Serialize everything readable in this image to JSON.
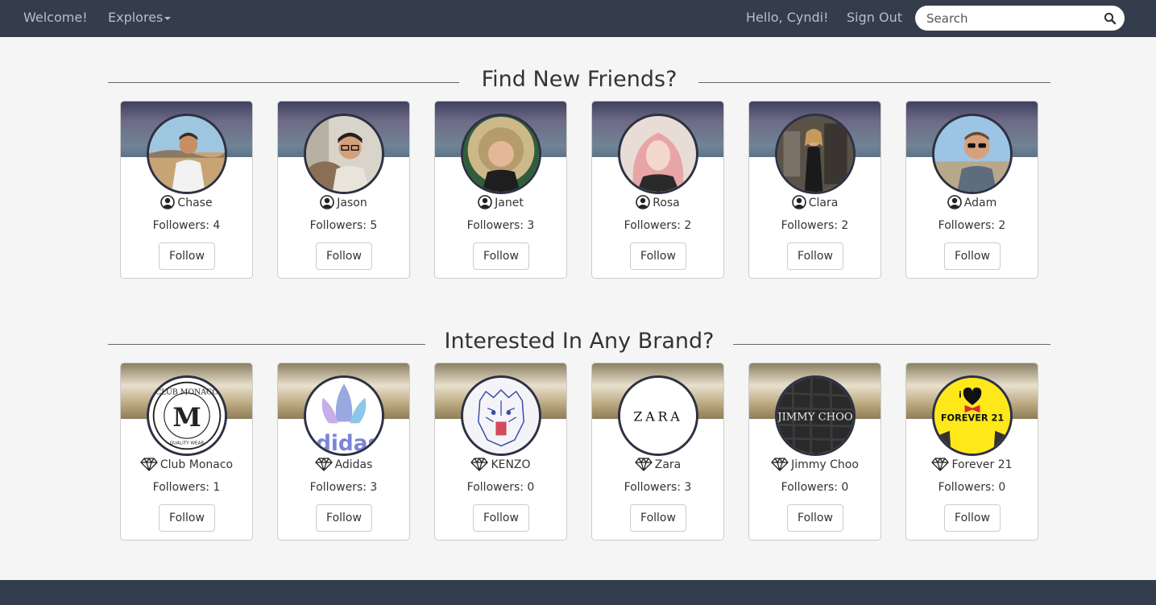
{
  "nav": {
    "welcome": "Welcome!",
    "explores": "Explores",
    "greeting": "Hello, Cyndi!",
    "signout": "Sign Out",
    "search_placeholder": "Search"
  },
  "friends_section": {
    "title": "Find New Friends?",
    "cards": [
      {
        "name": "Chase",
        "followers": "Followers: 4",
        "follow": "Follow"
      },
      {
        "name": "Jason",
        "followers": "Followers: 5",
        "follow": "Follow"
      },
      {
        "name": "Janet",
        "followers": "Followers: 3",
        "follow": "Follow"
      },
      {
        "name": "Rosa",
        "followers": "Followers: 2",
        "follow": "Follow"
      },
      {
        "name": "Clara",
        "followers": "Followers: 2",
        "follow": "Follow"
      },
      {
        "name": "Adam",
        "followers": "Followers: 2",
        "follow": "Follow"
      }
    ]
  },
  "brands_section": {
    "title": "Interested In Any Brand?",
    "cards": [
      {
        "name": "Club Monaco",
        "followers": "Followers: 1",
        "follow": "Follow",
        "logo_top": "CLUB MONACO",
        "logo_mark": "M",
        "logo_bottom": "QUALITY WEAR"
      },
      {
        "name": "Adidas",
        "followers": "Followers: 3",
        "follow": "Follow",
        "logo_text": "adidas"
      },
      {
        "name": "KENZO",
        "followers": "Followers: 0",
        "follow": "Follow"
      },
      {
        "name": "Zara",
        "followers": "Followers: 3",
        "follow": "Follow",
        "logo_text": "ZARA"
      },
      {
        "name": "Jimmy Choo",
        "followers": "Followers: 0",
        "follow": "Follow",
        "logo_text": "JIMMY CHOO"
      },
      {
        "name": "Forever 21",
        "followers": "Followers: 0",
        "follow": "Follow",
        "logo_small": "i",
        "logo_text": "FOREVER 21"
      }
    ]
  }
}
